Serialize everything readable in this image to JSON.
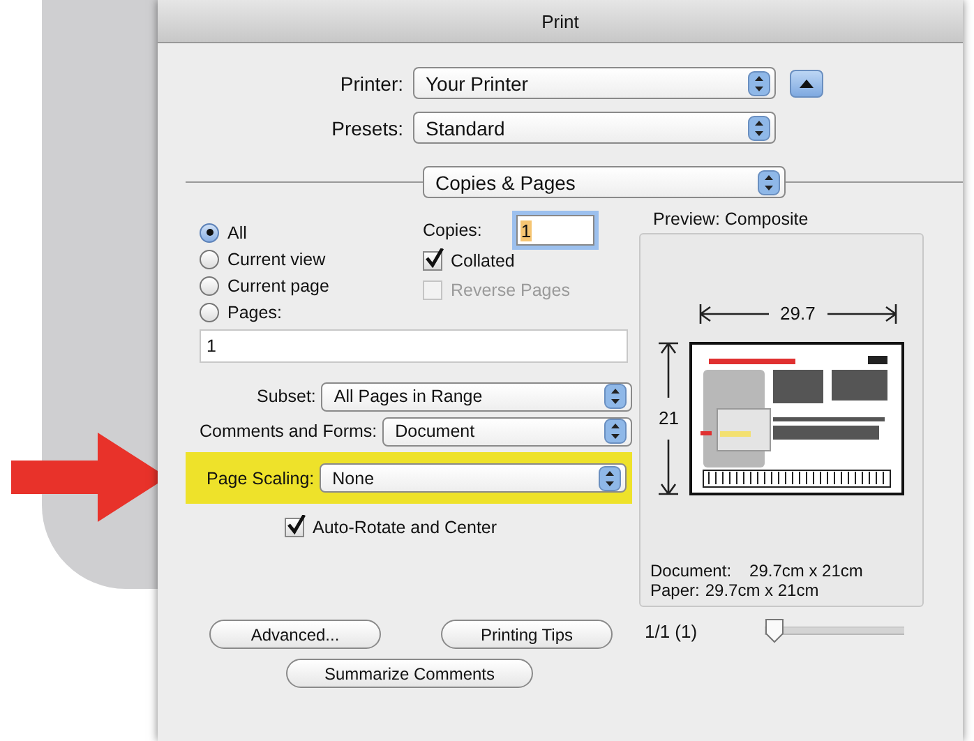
{
  "window": {
    "title": "Print"
  },
  "printer": {
    "label": "Printer:",
    "value": "Your Printer"
  },
  "presets": {
    "label": "Presets:",
    "value": "Standard"
  },
  "panel": {
    "value": "Copies & Pages"
  },
  "page_range": [
    {
      "label": "All",
      "selected": true
    },
    {
      "label": "Current view",
      "selected": false
    },
    {
      "label": "Current page",
      "selected": false
    },
    {
      "label": "Pages:",
      "selected": false
    }
  ],
  "pages_field": {
    "value": "1"
  },
  "copies": {
    "label": "Copies:",
    "value": "1"
  },
  "options": [
    {
      "label": "Collated",
      "checked": true,
      "disabled": false
    },
    {
      "label": "Reverse Pages",
      "checked": false,
      "disabled": true
    }
  ],
  "popups": [
    {
      "label": "Subset:",
      "value": "All Pages in Range",
      "highlighted": false
    },
    {
      "label": "Comments and Forms:",
      "value": "Document",
      "highlighted": false
    },
    {
      "label": "Page Scaling:",
      "value": "None",
      "highlighted": true
    }
  ],
  "auto_rotate": {
    "label": "Auto-Rotate and Center",
    "checked": true
  },
  "preview": {
    "title": "Preview: Composite",
    "width_label": "29.7",
    "height_label": "21",
    "document_label": "Document:",
    "document_value": "29.7cm x 21cm",
    "paper_label": "Paper:",
    "paper_value": "29.7cm x 21cm"
  },
  "buttons": [
    "Advanced...",
    "Printing Tips",
    "Summarize Comments"
  ],
  "page_indicator": "1/1 (1)",
  "page_slider": {
    "level": 0
  }
}
